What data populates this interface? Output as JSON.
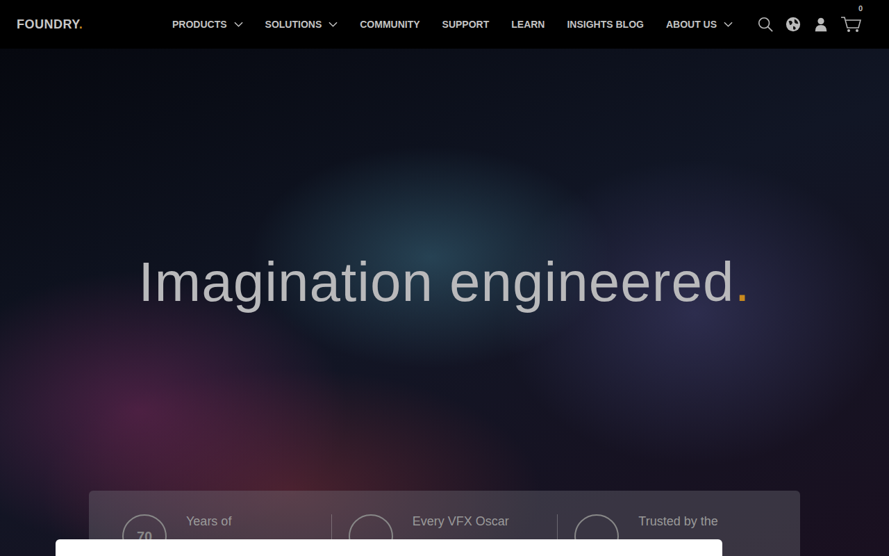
{
  "nav": {
    "logo": "FOUNDRY",
    "logo_dot": ".",
    "items": [
      {
        "label": "PRODUCTS",
        "dropdown": true
      },
      {
        "label": "SOLUTIONS",
        "dropdown": true
      },
      {
        "label": "COMMUNITY",
        "dropdown": false
      },
      {
        "label": "SUPPORT",
        "dropdown": false
      },
      {
        "label": "LEARN",
        "dropdown": false
      },
      {
        "label": "INSIGHTS BLOG",
        "dropdown": false
      },
      {
        "label": "ABOUT US",
        "dropdown": true
      }
    ],
    "cart_count": "0"
  },
  "hero": {
    "headline": "Imagination engineered",
    "accent": "."
  },
  "stats": [
    {
      "badge": "70",
      "text": "Years of"
    },
    {
      "badge": "",
      "text": "Every VFX Oscar"
    },
    {
      "badge": "",
      "text": "Trusted by the"
    }
  ],
  "modal": {
    "open": true
  }
}
